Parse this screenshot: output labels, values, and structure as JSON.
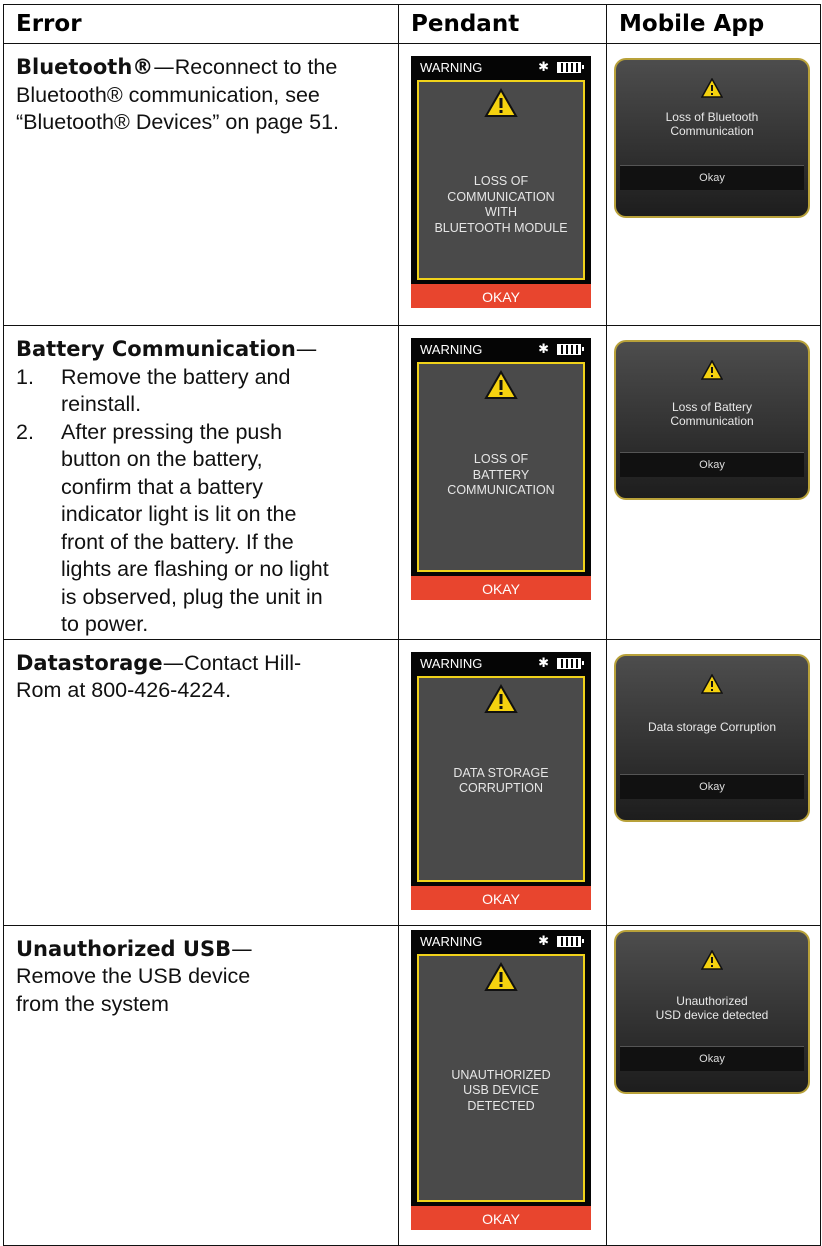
{
  "headers": {
    "error": "Error",
    "pendant": "Pendant",
    "app": "Mobile App"
  },
  "pendant_common": {
    "status": "WARNING",
    "okay": "OKAY",
    "bt_icon": "bluetooth-icon",
    "batt_icon": "battery-icon"
  },
  "app_common": {
    "okay": "Okay"
  },
  "colors": {
    "yellow_frame": "#f0d21a",
    "okay_red": "#e8452e",
    "app_gold": "#b8a13a"
  },
  "rows": [
    {
      "title": "Bluetooth®",
      "text_l1": "Reconnect to the",
      "text_l2": "Bluetooth® communication, see",
      "text_l3": "“Bluetooth® Devices” on page 51.",
      "pendant_lines": [
        "LOSS OF",
        "COMMUNICATION",
        "WITH",
        "BLUETOOTH MODULE"
      ],
      "app_lines": [
        "Loss of Bluetooth",
        "Communication"
      ]
    },
    {
      "title": "Battery  Communication",
      "steps": [
        {
          "num": "1.",
          "lines": [
            "Remove the battery and",
            "reinstall."
          ]
        },
        {
          "num": "2.",
          "lines": [
            "After pressing the push",
            "button on the battery,",
            "confirm that a battery",
            "indicator light is lit on the",
            "front of the battery. If the",
            "lights are flashing or no light",
            "is observed, plug the unit in",
            "to power."
          ]
        }
      ],
      "pendant_lines": [
        "LOSS OF",
        "BATTERY",
        "COMMUNICATION"
      ],
      "app_lines": [
        "Loss of Battery",
        "Communication"
      ]
    },
    {
      "title": "Datastorage",
      "text_l1": "Contact Hill-",
      "text_l2": "Rom at 800-426-4224.",
      "pendant_lines": [
        "DATA STORAGE",
        "CORRUPTION"
      ],
      "app_lines": [
        "Data storage Corruption"
      ]
    },
    {
      "title": "Unauthorized USB",
      "text_l1": "Remove the USB device",
      "text_l2": "from the system",
      "pendant_lines": [
        "UNAUTHORIZED",
        "USB DEVICE",
        "DETECTED"
      ],
      "app_lines": [
        "Unauthorized",
        "USD device detected"
      ]
    }
  ]
}
